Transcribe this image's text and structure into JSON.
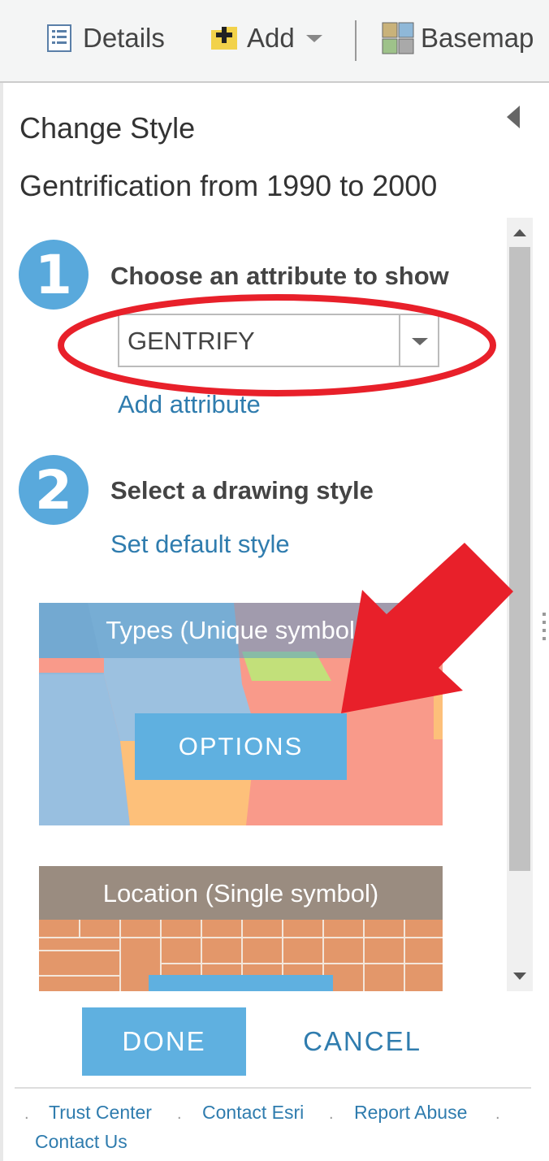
{
  "toolbar": {
    "details_label": "Details",
    "add_label": "Add",
    "basemap_label": "Basemap"
  },
  "panel": {
    "title": "Change Style",
    "layer_name": "Gentrification from 1990 to 2000"
  },
  "step1": {
    "number": "1",
    "title": "Choose an attribute to show",
    "selected_attribute": "GENTRIFY",
    "add_attribute_link": "Add attribute"
  },
  "step2": {
    "number": "2",
    "title": "Select a drawing style",
    "default_style_link": "Set default style"
  },
  "styles": [
    {
      "label": "Types (Unique symbols)",
      "options_label": "OPTIONS"
    },
    {
      "label": "Location (Single symbol)"
    }
  ],
  "actions": {
    "done_label": "DONE",
    "cancel_label": "CANCEL"
  },
  "footer": {
    "links": [
      "Trust Center",
      "Contact Esri",
      "Report Abuse",
      "Contact Us"
    ]
  },
  "colors": {
    "accent": "#5fb0e0",
    "link": "#2f7cae",
    "annotation_red": "#e8202a"
  }
}
